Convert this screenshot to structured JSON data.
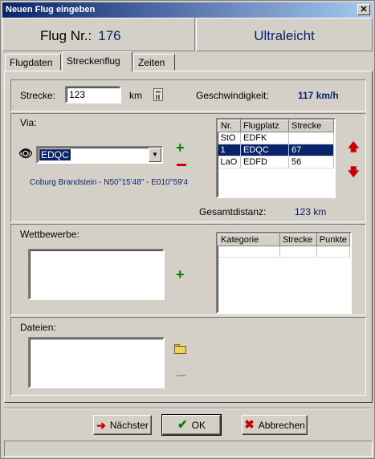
{
  "window": {
    "title": "Neuen Flug eingeben",
    "close_glyph": "✕"
  },
  "header": {
    "flug_label": "Flug Nr.:",
    "flug_nr": "176",
    "typ": "Ultraleicht"
  },
  "tabs": [
    {
      "label": "Flugdaten"
    },
    {
      "label": "Streckenflug"
    },
    {
      "label": "Zeiten"
    }
  ],
  "strecke": {
    "label": "Strecke:",
    "value": "123",
    "unit": "km"
  },
  "geschwindigkeit": {
    "label": "Geschwindigkeit:",
    "value": "117 km/h"
  },
  "via": {
    "label": "Via:",
    "selected": "EDQC",
    "info": "Coburg Brandstein - N50°15'48\" - E010°59'4",
    "columns": [
      "Nr.",
      "Flugplatz",
      "Strecke"
    ],
    "rows": [
      {
        "nr": "StO",
        "platz": "EDFK",
        "strecke": ""
      },
      {
        "nr": "1",
        "platz": "EDQC",
        "strecke": "67"
      },
      {
        "nr": "LaO",
        "platz": "EDFD",
        "strecke": "56"
      }
    ],
    "selected_row": 1
  },
  "gesamtdistanz": {
    "label": "Gesamtdistanz:",
    "value": "123",
    "unit": "km"
  },
  "wettbewerbe": {
    "label": "Wettbewerbe:",
    "columns": [
      "Kategorie",
      "Strecke",
      "Punkte"
    ]
  },
  "dateien": {
    "label": "Dateien:"
  },
  "buttons": {
    "next": "Nächster",
    "ok": "OK",
    "cancel": "Abbrechen"
  },
  "colors": {
    "accent": "#0a246a",
    "add": "#008000",
    "remove": "#cc0000"
  }
}
